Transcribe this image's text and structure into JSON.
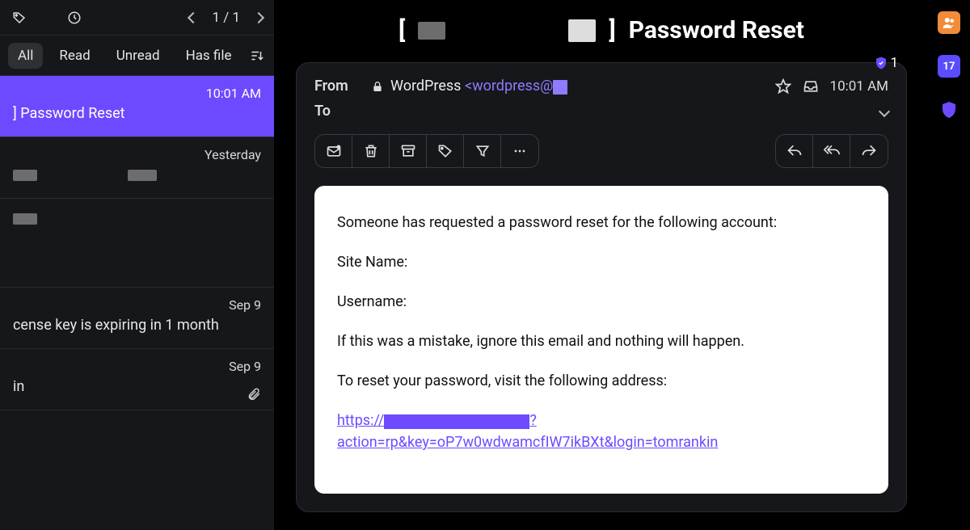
{
  "pager": {
    "label": "1 / 1"
  },
  "filters": {
    "all": "All",
    "read": "Read",
    "unread": "Unread",
    "hasfile": "Has file"
  },
  "list": [
    {
      "when": "10:01 AM",
      "subject": "] Password Reset",
      "selected": true
    },
    {
      "when": "Yesterday",
      "subject": ""
    },
    {
      "when": "",
      "subject": ""
    },
    {
      "when": "Sep 9",
      "subject": "cense key is expiring in 1 month"
    },
    {
      "when": "Sep 9",
      "subject": "in",
      "attach": true
    }
  ],
  "header_title": "Password Reset",
  "badge_count": "1",
  "from": {
    "label": "From",
    "name": "WordPress",
    "addr_prefix": "<wordpress@"
  },
  "to_label": "To",
  "time": "10:01 AM",
  "body": {
    "p1": "Someone has requested a password reset for the following account:",
    "p2": "Site Name:",
    "p3": "Username:",
    "p4": "If this was a mistake, ignore this email and nothing will happen.",
    "p5": "To reset your password, visit the following address:",
    "link_pre": "https://",
    "link_mid": "?",
    "link_post": "action=rp&key=oP7w0wdwamcfIW7ikBXt&login=tomrankin"
  },
  "calendar_day": "17"
}
